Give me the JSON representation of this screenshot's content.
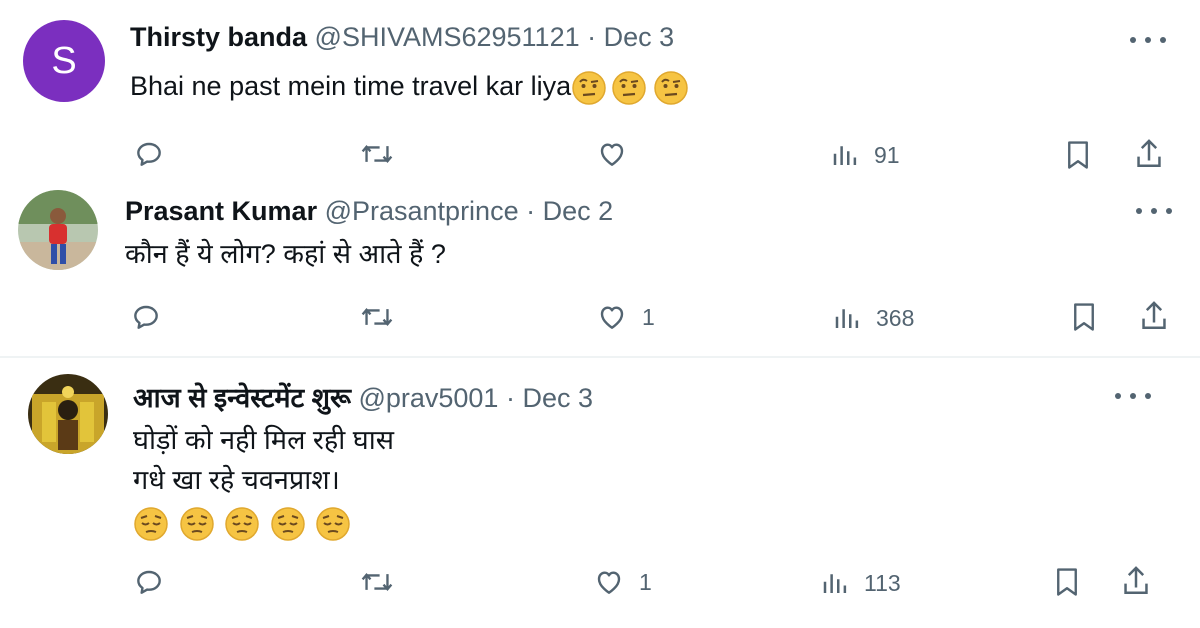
{
  "replies": [
    {
      "name": "Thirsty banda",
      "handle": "@SHIVAMS62951121",
      "date": "Dec 3",
      "avatar_letter": "S",
      "lines": [
        "Bhai ne past mein time travel kar liya"
      ],
      "emoji_kind": "face-with-raised-eyebrow",
      "emoji_count": 3,
      "likes": "",
      "views": "91"
    },
    {
      "name": "Prasant Kumar",
      "handle": "@Prasantprince",
      "date": "Dec 2",
      "lines": [
        "कौन हैं ये लोग? कहां से आते हैं ?"
      ],
      "likes": "1",
      "views": "368"
    },
    {
      "name": "आज से इन्वेस्टमेंट शुरू",
      "handle": "@prav5001",
      "date": "Dec 3",
      "lines": [
        "घोड़ों को नही मिल रही घास",
        "गधे खा रहे चवनप्राश।"
      ],
      "emoji_kind": "pensive-face",
      "emoji_count": 5,
      "likes": "1",
      "views": "113"
    }
  ],
  "icons": {
    "reply": "reply-icon",
    "repost": "repost-icon",
    "like": "like-icon",
    "views": "views-icon",
    "bookmark": "bookmark-icon",
    "share": "share-icon",
    "more": "more-icon"
  },
  "colors": {
    "avatar_purple": "#7b2fbf",
    "muted": "#536471",
    "emoji_yellow": "#f6c443"
  }
}
